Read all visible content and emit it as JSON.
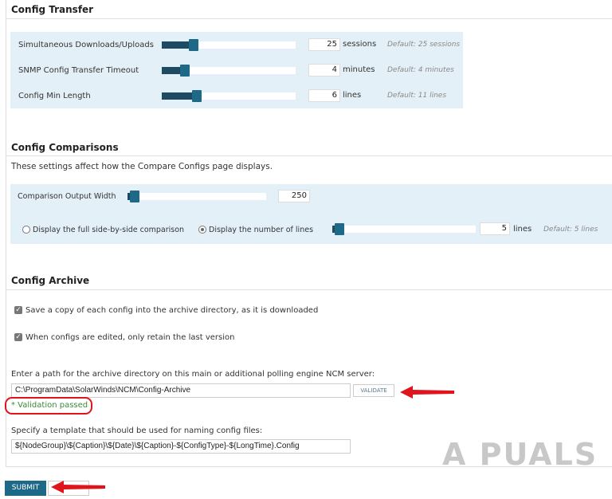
{
  "transfer": {
    "title": "Config Transfer",
    "rows": [
      {
        "label": "Simultaneous Downloads/Uploads",
        "value": "25",
        "unit": "sessions",
        "default": "Default: 25 sessions",
        "fraction": 0.24
      },
      {
        "label": "SNMP Config Transfer Timeout",
        "value": "4",
        "unit": "minutes",
        "default": "Default: 4 minutes",
        "fraction": 0.17
      },
      {
        "label": "Config Min Length",
        "value": "6",
        "unit": "lines",
        "default": "Default: 11 lines",
        "fraction": 0.26
      }
    ]
  },
  "comparisons": {
    "title": "Config Comparisons",
    "description": "These settings affect how the Compare Configs page displays.",
    "width_label": "Comparison Output Width",
    "width_value": "250",
    "width_fraction": 0.05,
    "radio_full": "Display the full side-by-side comparison",
    "radio_lines": "Display the number of lines",
    "selected": "lines",
    "lines_value": "5",
    "lines_unit": "lines",
    "lines_default": "Default: 5 lines",
    "lines_fraction": 0.05
  },
  "archive": {
    "title": "Config Archive",
    "check1": "Save a copy of each config into the archive directory, as it is downloaded",
    "check2": "When configs are edited, only retain the last version",
    "path_label": "Enter a path for the archive directory on this main or additional polling engine NCM server:",
    "path_value": "C:\\ProgramData\\SolarWinds\\NCM\\Config-Archive",
    "validate": "VALIDATE",
    "validation": "* Validation passed",
    "template_label": "Specify a template that should be used for naming config files:",
    "template_value": "${NodeGroup}\\${Caption}\\${Date}\\${Caption}-${ConfigType}-${LongTime}.Config"
  },
  "submit": "SUBMIT",
  "watermark": "APPUALS",
  "colors": {
    "accent": "#1d6987",
    "panel": "#e4f0f8",
    "success": "#3a8a3a",
    "annotation": "#e0141c"
  }
}
